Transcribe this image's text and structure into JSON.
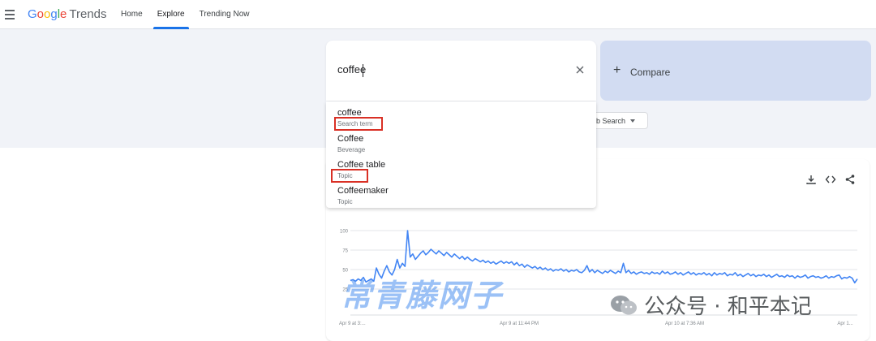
{
  "header": {
    "logo_letters": [
      "G",
      "o",
      "o",
      "g",
      "l",
      "e"
    ],
    "logo_suffix": "Trends",
    "tabs": [
      {
        "label": "Home",
        "active": false
      },
      {
        "label": "Explore",
        "active": true
      },
      {
        "label": "Trending Now",
        "active": false
      }
    ]
  },
  "search": {
    "value": "coffee",
    "clear_icon": "close-icon"
  },
  "compare": {
    "plus": "+",
    "label": "Compare"
  },
  "suggestions": [
    {
      "title": "coffee",
      "type": "Search term"
    },
    {
      "title": "Coffee",
      "type": "Beverage"
    },
    {
      "title": "Coffee table",
      "type": "Topic"
    },
    {
      "title": "Coffeemaker",
      "type": "Topic"
    }
  ],
  "filter": {
    "search_type_label": "ob Search"
  },
  "chart_card": {
    "icons": [
      "download-icon",
      "embed-code-icon",
      "share-icon"
    ]
  },
  "chart_data": {
    "type": "line",
    "y_ticks": [
      "100",
      "75",
      "50",
      "25"
    ],
    "ylim": [
      0,
      100
    ],
    "x_tick_labels": [
      "Apr 9 at 3:...",
      "Apr 9 at 11:44 PM",
      "Apr 10 at 7:36 AM",
      "Apr 1..."
    ],
    "series": [
      {
        "color": "#4285f4",
        "values": [
          36,
          37,
          35,
          38,
          36,
          40,
          34,
          36,
          38,
          35,
          52,
          44,
          39,
          48,
          55,
          47,
          43,
          50,
          63,
          52,
          58,
          54,
          100,
          66,
          70,
          63,
          67,
          71,
          74,
          69,
          72,
          76,
          73,
          70,
          74,
          71,
          68,
          72,
          69,
          66,
          70,
          67,
          64,
          67,
          63,
          66,
          63,
          61,
          64,
          62,
          60,
          62,
          59,
          61,
          58,
          60,
          57,
          59,
          61,
          58,
          60,
          58,
          60,
          56,
          59,
          55,
          57,
          53,
          56,
          54,
          52,
          54,
          51,
          53,
          50,
          52,
          49,
          51,
          48,
          50,
          49,
          51,
          48,
          50,
          47,
          49,
          48,
          50,
          47,
          46,
          49,
          55,
          47,
          50,
          46,
          49,
          47,
          45,
          48,
          46,
          49,
          47,
          45,
          48,
          46,
          58,
          46,
          49,
          45,
          47,
          44,
          46,
          47,
          45,
          46,
          44,
          47,
          45,
          46,
          44,
          48,
          45,
          47,
          44,
          45,
          47,
          44,
          46,
          43,
          45,
          47,
          44,
          46,
          43,
          45,
          44,
          46,
          43,
          45,
          42,
          46,
          43,
          45,
          44,
          46,
          42,
          44,
          43,
          46,
          42,
          44,
          41,
          43,
          45,
          42,
          44,
          41,
          43,
          42,
          44,
          41,
          43,
          40,
          42,
          44,
          41,
          42,
          40,
          43,
          41,
          42,
          39,
          42,
          40,
          41,
          43,
          39,
          41,
          42,
          40,
          41,
          39,
          40,
          42,
          39,
          41,
          40,
          42,
          43,
          38,
          40,
          39,
          41,
          39,
          33,
          38
        ]
      }
    ]
  },
  "watermarks": {
    "left_text": "常青藤网子",
    "right_text": "公众号 · 和平本记",
    "right_icon": "wechat-icon"
  },
  "colors": {
    "accent": "#1a73e8",
    "series": "#4285f4",
    "compare_bg": "#d2dcf2",
    "highlight": "#d93025"
  }
}
